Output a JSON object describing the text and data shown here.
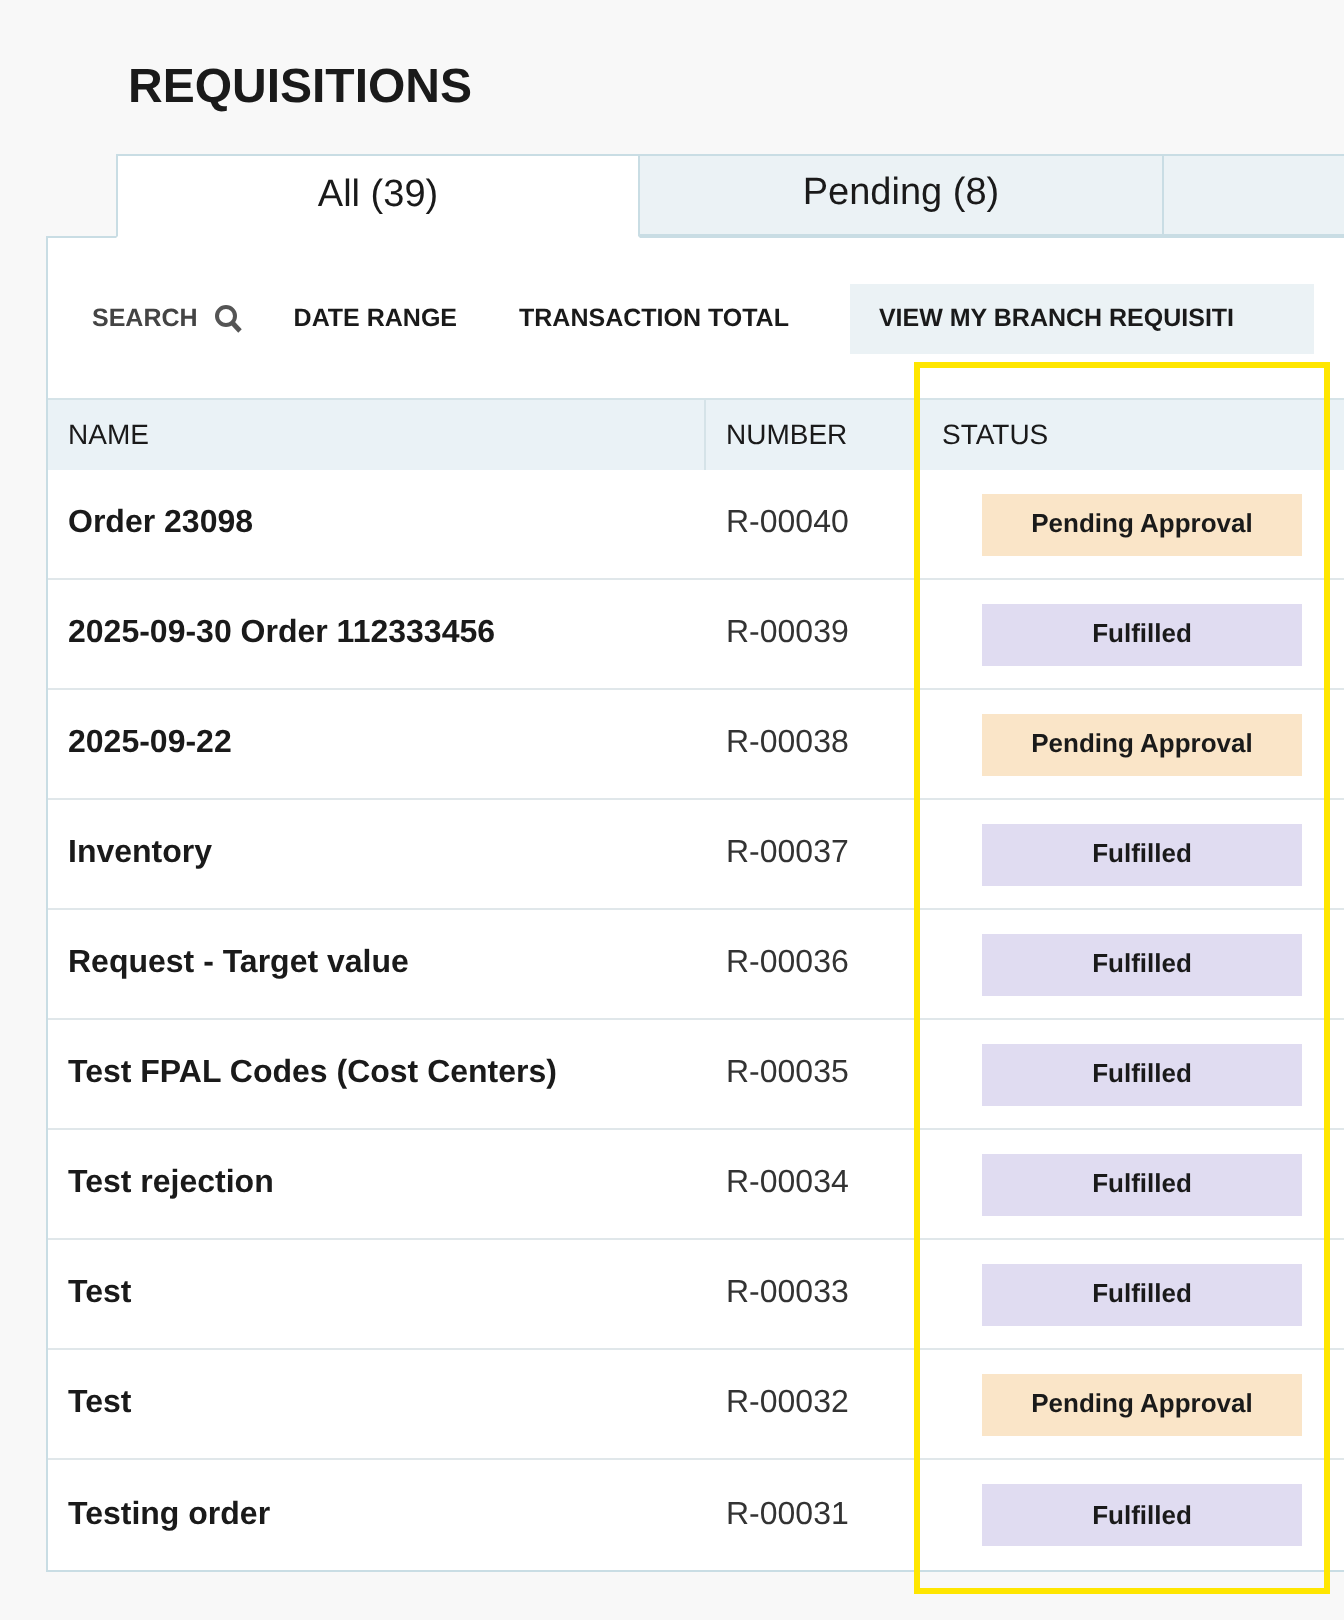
{
  "page_title": "REQUISITIONS",
  "tabs": [
    {
      "label": "All (39)",
      "selected": true
    },
    {
      "label": "Pending (8)",
      "selected": false
    }
  ],
  "toolbar": {
    "search": "SEARCH",
    "filters": [
      "DATE RANGE",
      "TRANSACTION TOTAL"
    ],
    "branch_button": "VIEW MY BRANCH REQUISITI"
  },
  "table": {
    "columns": [
      "NAME",
      "NUMBER",
      "STATUS"
    ],
    "rows": [
      {
        "name": "Order 23098",
        "number": "R-00040",
        "status": "Pending Approval",
        "kind": "pending"
      },
      {
        "name": "2025-09-30 Order 112333456",
        "number": "R-00039",
        "status": "Fulfilled",
        "kind": "fulfilled"
      },
      {
        "name": "2025-09-22",
        "number": "R-00038",
        "status": "Pending Approval",
        "kind": "pending"
      },
      {
        "name": "Inventory",
        "number": "R-00037",
        "status": "Fulfilled",
        "kind": "fulfilled"
      },
      {
        "name": "Request - Target value",
        "number": "R-00036",
        "status": "Fulfilled",
        "kind": "fulfilled"
      },
      {
        "name": "Test FPAL Codes (Cost Centers)",
        "number": "R-00035",
        "status": "Fulfilled",
        "kind": "fulfilled"
      },
      {
        "name": "Test rejection",
        "number": "R-00034",
        "status": "Fulfilled",
        "kind": "fulfilled"
      },
      {
        "name": "Test",
        "number": "R-00033",
        "status": "Fulfilled",
        "kind": "fulfilled"
      },
      {
        "name": "Test",
        "number": "R-00032",
        "status": "Pending Approval",
        "kind": "pending"
      },
      {
        "name": "Testing order",
        "number": "R-00031",
        "status": "Fulfilled",
        "kind": "fulfilled"
      }
    ]
  },
  "highlight": {
    "color": "#ffe600"
  }
}
